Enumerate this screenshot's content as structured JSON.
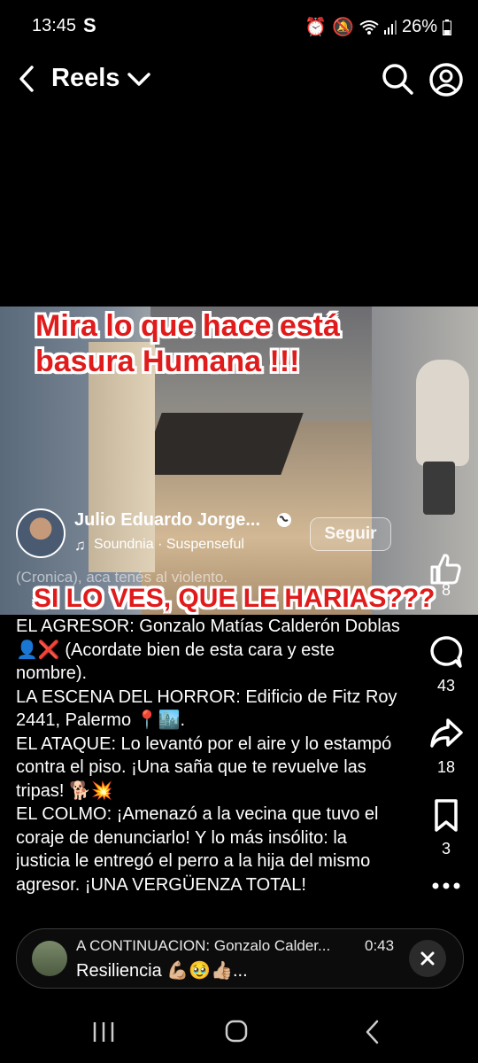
{
  "status_bar": {
    "time": "13:45",
    "carrier_icon": "S",
    "battery": "26%"
  },
  "header": {
    "title": "Reels"
  },
  "video": {
    "overlay_top": "Mira lo que hace está basura Humana !!!",
    "overlay_bottom": "SI LO VES, QUE LE HARIAS???",
    "watermark": "(Cronica), aca tenés al violento."
  },
  "author": {
    "name": "Julio Eduardo Jorge...",
    "audio": "Soundnia · Suspenseful",
    "follow_label": "Seguir"
  },
  "actions": {
    "likes": "8",
    "comments": "43",
    "shares": "18",
    "saves": "3"
  },
  "caption": [
    "EL AGRESOR: Gonzalo Matías Calderón Doblas 👤❌ (Acordate bien de esta cara y este nombre).",
    "LA ESCENA DEL HORROR: Edificio de Fitz Roy 2441, Palermo 📍🏙️.",
    "EL ATAQUE: Lo levantó por el aire y lo estampó contra el piso. ¡Una saña que te revuelve las tripas! 🐕💥",
    "EL COLMO: ¡Amenazó a la vecina que tuvo el coraje de denunciarlo! Y lo más insólito: la justicia le entregó el perro a la hija del mismo agresor. ¡UNA VERGÜENZA TOTAL!"
  ],
  "up_next": {
    "title": "A CONTINUACION: Gonzalo Calder...",
    "duration": "0:43",
    "subtitle": "Resiliencia 💪🏼🥹👍🏼..."
  }
}
